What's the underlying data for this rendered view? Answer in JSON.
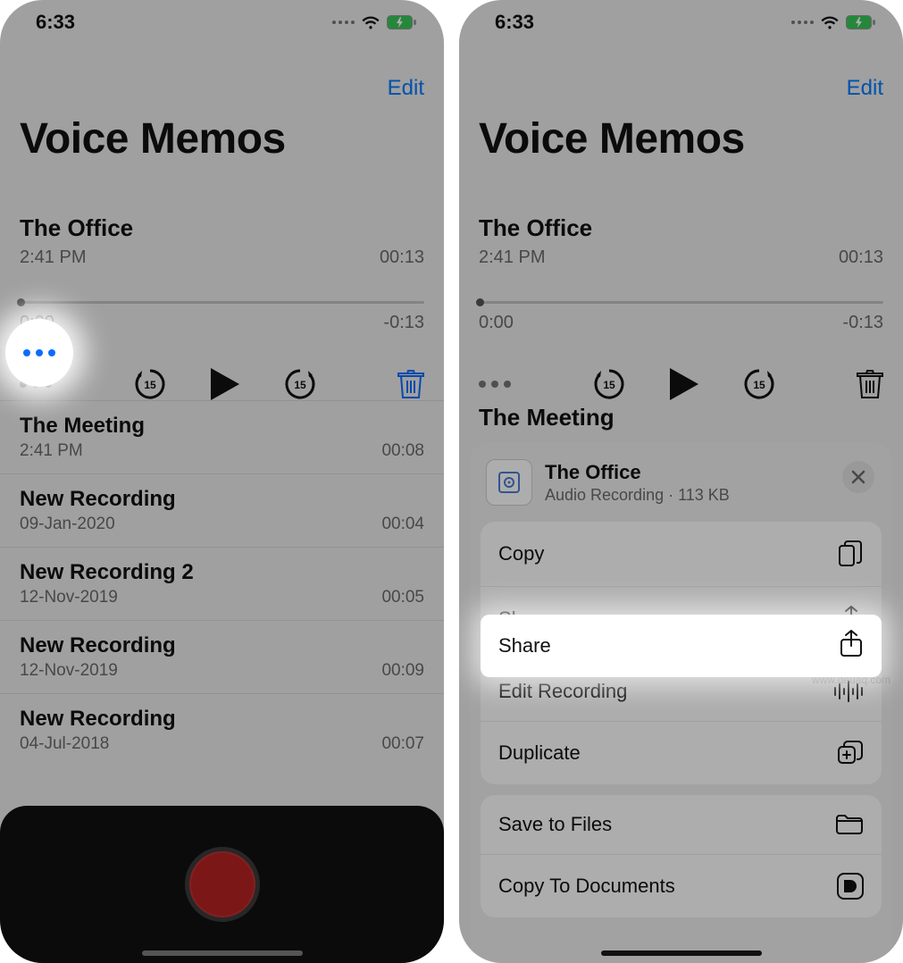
{
  "status": {
    "time": "6:33"
  },
  "app": {
    "title": "Voice Memos",
    "edit": "Edit"
  },
  "selected": {
    "title": "The Office",
    "subtitle": "2:41 PM",
    "duration": "00:13",
    "time_start": "0:00",
    "time_end": "-0:13"
  },
  "memos": [
    {
      "title": "The Meeting",
      "sub": "2:41 PM",
      "dur": "00:08"
    },
    {
      "title": "New Recording",
      "sub": "09-Jan-2020",
      "dur": "00:04"
    },
    {
      "title": "New Recording 2",
      "sub": "12-Nov-2019",
      "dur": "00:05"
    },
    {
      "title": "New Recording",
      "sub": "12-Nov-2019",
      "dur": "00:09"
    },
    {
      "title": "New Recording",
      "sub": "04-Jul-2018",
      "dur": "00:07"
    }
  ],
  "right_second_memo": "The Meeting",
  "share_sheet": {
    "file_title": "The Office",
    "file_meta": "Audio Recording · 113 KB",
    "actions": {
      "copy": "Copy",
      "share": "Share",
      "edit": "Edit Recording",
      "duplicate": "Duplicate",
      "save": "Save to Files",
      "copy_docs": "Copy To Documents"
    }
  },
  "watermark": "www.deuaq.com",
  "colors": {
    "accent": "#007aff",
    "danger": "#ff3b30",
    "record": "#b62222"
  }
}
